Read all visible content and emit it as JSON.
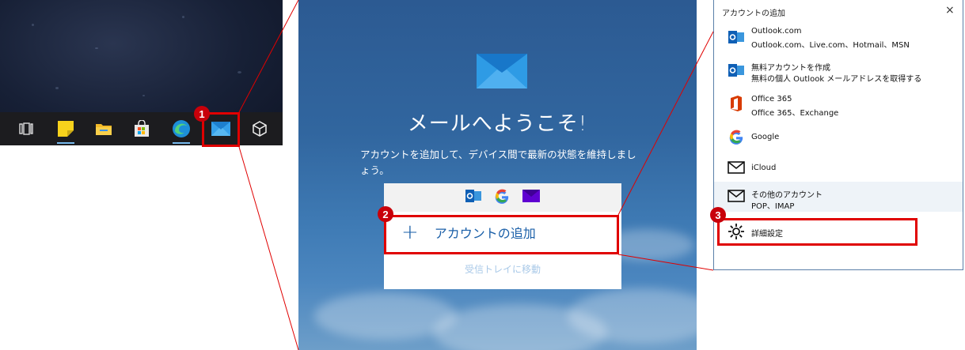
{
  "mail_welcome": {
    "title": "メールへようこそ!",
    "description": "アカウントを追加して、デバイス間で最新の状態を維持しましょう。",
    "add_account": "アカウントの追加",
    "go_to_inbox": "受信トレイに移動"
  },
  "dialog": {
    "title": "アカウントの追加",
    "close": "×",
    "accounts": [
      {
        "name": "Outlook.com",
        "detail": "Outlook.com、Live.com、Hotmail、MSN",
        "icon": "outlook-icon"
      },
      {
        "name": "無料アカウントを作成",
        "detail": "無料の個人 Outlook メールアドレスを取得する",
        "icon": "outlook-icon"
      },
      {
        "name": "Office 365",
        "detail": "Office 365、Exchange",
        "icon": "office-icon"
      },
      {
        "name": "Google",
        "detail": "",
        "icon": "google-icon"
      },
      {
        "name": "iCloud",
        "detail": "",
        "icon": "envelope-icon"
      },
      {
        "name": "その他のアカウント",
        "detail": "POP、IMAP",
        "icon": "envelope-icon"
      },
      {
        "name": "詳細設定",
        "detail": "",
        "icon": "gear-icon"
      }
    ]
  },
  "callouts": {
    "step1": "1",
    "step2": "2",
    "step3": "3"
  },
  "colors": {
    "callout_red": "#e00000",
    "accent_blue": "#1a5fa8",
    "mail_icon_blue": "#2e9be5"
  }
}
